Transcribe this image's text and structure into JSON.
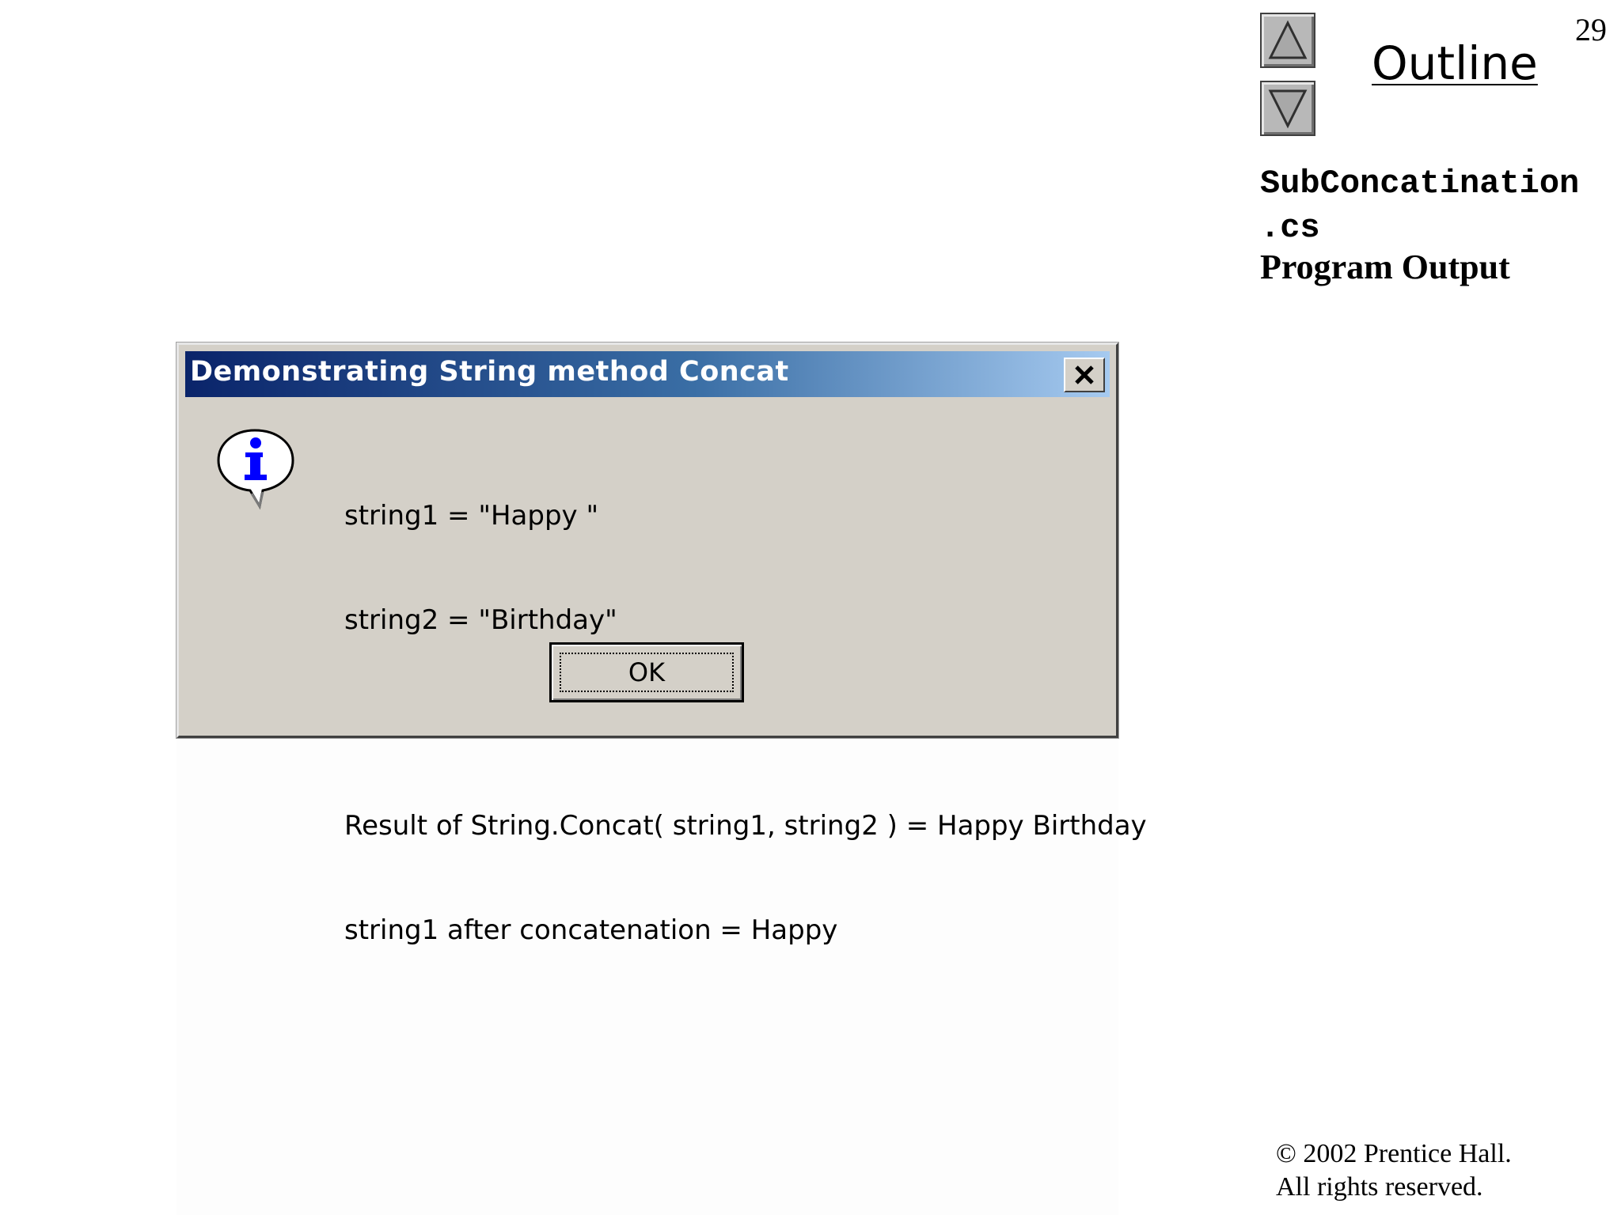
{
  "slide": {
    "page_number": "29",
    "outline_label": "Outline",
    "side_code_line1": "SubConcatination",
    "side_code_line2": ".cs",
    "side_subtitle": "Program Output",
    "copyright_line1": "© 2002 Prentice Hall.",
    "copyright_line2": "All rights reserved."
  },
  "dialog": {
    "title": "Demonstrating String method Concat",
    "message": {
      "line1": "string1 = \"Happy \"",
      "line2": "string2 = \"Birthday\"",
      "line3": "Result of String.Concat( string1, string2 ) = Happy Birthday",
      "line4": "string1 after concatenation = Happy"
    },
    "ok_label": "OK",
    "icon": "info-balloon-icon"
  },
  "colors": {
    "title_start": "#0a246a",
    "title_end": "#a6caf0",
    "dialog_face": "#d4d0c8",
    "info_blue": "#0000ff"
  }
}
